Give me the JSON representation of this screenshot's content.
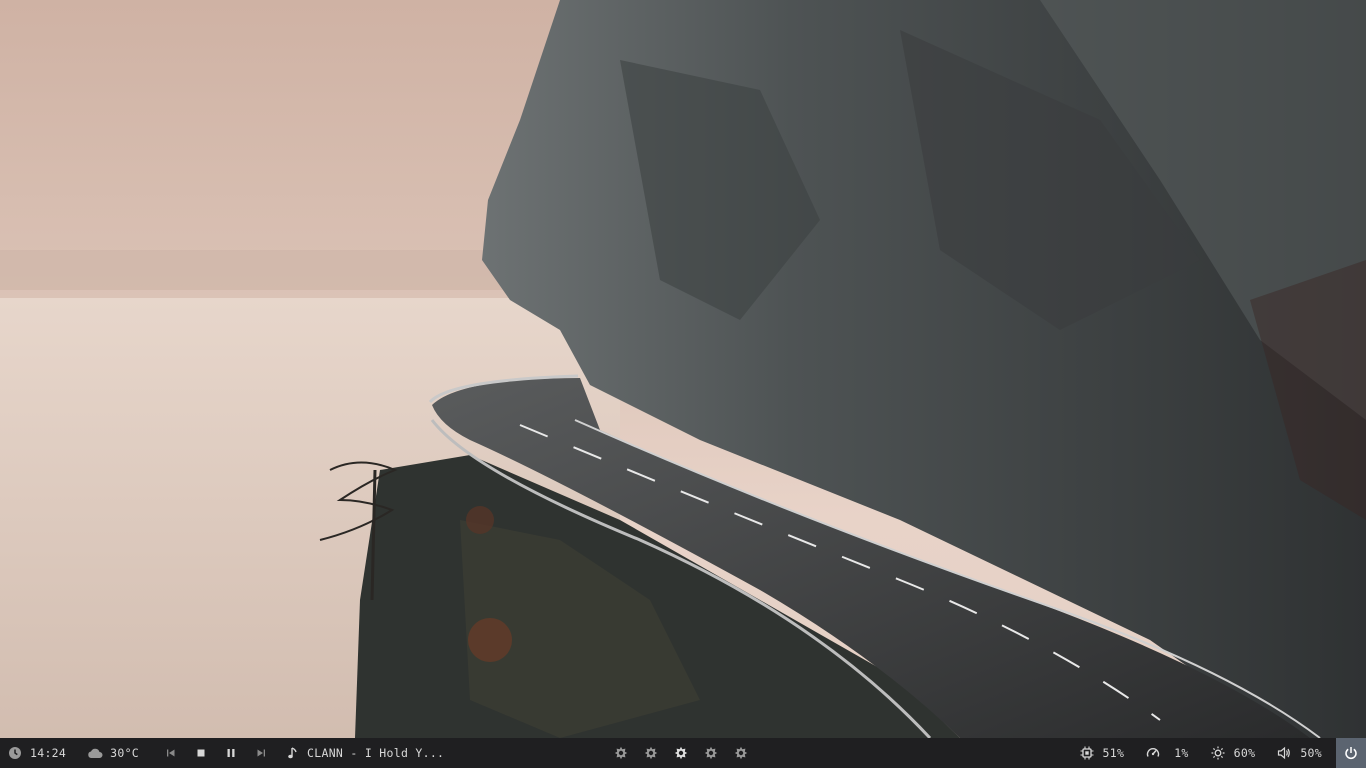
{
  "colors": {
    "bar_bg": "#1f1f21",
    "bar_text": "#d8d8d8",
    "icon_gray": "#9a9a9a",
    "power_bg": "#5b6470",
    "sky": "#e6cfc3",
    "rock": "#4a4e50"
  },
  "statusbar": {
    "clock": {
      "icon": "clock-icon",
      "value": "14:24"
    },
    "weather": {
      "icon": "cloud-icon",
      "value": "30°C"
    },
    "media": {
      "prev_icon": "skip-back-icon",
      "stop_icon": "stop-icon",
      "pause_icon": "pause-icon",
      "next_icon": "skip-forward-icon",
      "note_icon": "music-note-icon",
      "track": "CLANN - I Hold Y..."
    },
    "workspaces": [
      {
        "icon": "workspace-icon",
        "active": false
      },
      {
        "icon": "workspace-icon",
        "active": false
      },
      {
        "icon": "workspace-icon",
        "active": true
      },
      {
        "icon": "workspace-icon",
        "active": false
      },
      {
        "icon": "workspace-icon",
        "active": false
      }
    ],
    "cpu": {
      "icon": "cpu-icon",
      "value": "51%"
    },
    "memory": {
      "icon": "gauge-icon",
      "value": "1%"
    },
    "brightness": {
      "icon": "sun-icon",
      "value": "60%"
    },
    "volume": {
      "icon": "speaker-icon",
      "value": "50%"
    },
    "power": {
      "icon": "power-icon"
    }
  }
}
